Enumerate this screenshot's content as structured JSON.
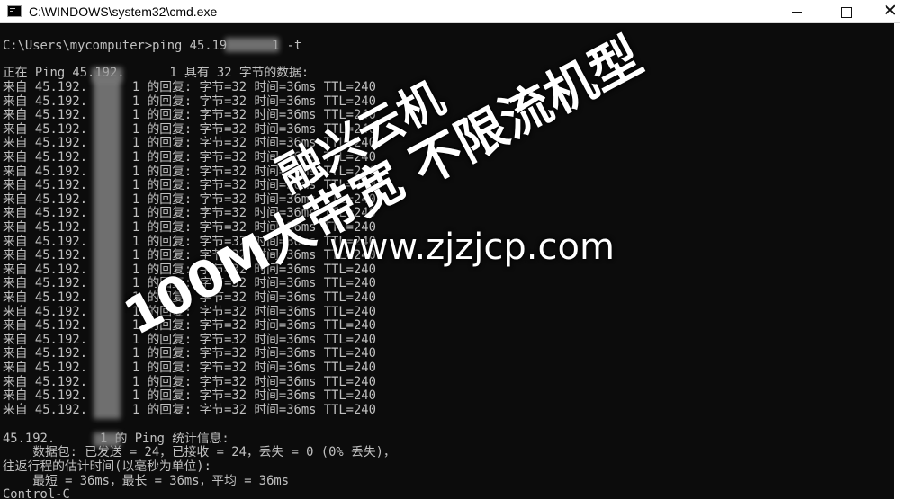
{
  "window": {
    "title": "C:\\WINDOWS\\system32\\cmd.exe",
    "controls": {
      "minimize": "minimize-icon",
      "maximize": "maximize-icon",
      "close": "close-icon"
    }
  },
  "console": {
    "command": "C:\\Users\\mycomputer>ping 45.19      1 -t",
    "header": "正在 Ping 45.192.      1 具有 32 字节的数据:",
    "replies": [
      "来自 45.192.      1 的回复: 字节=32 时间=36ms TTL=240",
      "来自 45.192.      1 的回复: 字节=32 时间=36ms TTL=240",
      "来自 45.192.      1 的回复: 字节=32 时间=36ms TTL=240",
      "来自 45.192.      1 的回复: 字节=32 时间=36ms TTL=240",
      "来自 45.192.      1 的回复: 字节=32 时间=36ms TTL=240",
      "来自 45.192.      1 的回复: 字节=32 时间=36ms TTL=240",
      "来自 45.192.      1 的回复: 字节=32 时间=36ms TTL=240",
      "来自 45.192.      1 的回复: 字节=32 时间=36ms TTL=240",
      "来自 45.192.      1 的回复: 字节=32 时间=36ms TTL=240",
      "来自 45.192.      1 的回复: 字节=32 时间=36ms TTL=240",
      "来自 45.192.      1 的回复: 字节=32 时间=36ms TTL=240",
      "来自 45.192.      1 的回复: 字节=32 时间=36ms TTL=240",
      "来自 45.192.      1 的回复: 字节=32 时间=36ms TTL=240",
      "来自 45.192.      1 的回复: 字节=32 时间=36ms TTL=240",
      "来自 45.192.      1 的回复: 字节=32 时间=36ms TTL=240",
      "来自 45.192.      1 的回复: 字节=32 时间=36ms TTL=240",
      "来自 45.192.      1 的回复: 字节=32 时间=36ms TTL=240",
      "来自 45.192.      1 的回复: 字节=32 时间=36ms TTL=240",
      "来自 45.192.      1 的回复: 字节=32 时间=36ms TTL=240",
      "来自 45.192.      1 的回复: 字节=32 时间=36ms TTL=240",
      "来自 45.192.      1 的回复: 字节=32 时间=36ms TTL=240",
      "来自 45.192.      1 的回复: 字节=32 时间=36ms TTL=240",
      "来自 45.192.      1 的回复: 字节=32 时间=36ms TTL=240",
      "来自 45.192.      1 的回复: 字节=32 时间=36ms TTL=240"
    ],
    "stats_title": "45.192.      1 的 Ping 统计信息:",
    "stats_packets": "    数据包: 已发送 = 24，已接收 = 24，丢失 = 0 (0% 丢失)，",
    "stats_rtt_title": "往返行程的估计时间(以毫秒为单位):",
    "stats_rtt": "    最短 = 36ms，最长 = 36ms，平均 = 36ms",
    "interrupt": "Control-C"
  },
  "watermark": {
    "line1": "融兴云机",
    "line2": "不限流机型",
    "line3": "100M大带宽",
    "site": "www.zjzjcp.com"
  },
  "colors": {
    "console_bg": "#0c0c0c",
    "console_text": "#c0c0c0",
    "titlebar_bg": "#ffffff"
  }
}
